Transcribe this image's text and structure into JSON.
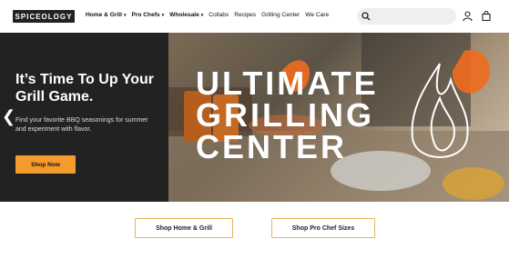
{
  "brand": {
    "logo_text": "SPICEOLOGY"
  },
  "nav": {
    "items": [
      {
        "label": "Home & Grill",
        "caret": "▾"
      },
      {
        "label": "Pro Chefs",
        "caret": "▾"
      },
      {
        "label": "Wholesale",
        "caret": "▾"
      },
      {
        "label": "Collabs",
        "caret": ""
      },
      {
        "label": "Recipes",
        "caret": ""
      },
      {
        "label": "Grilling Center",
        "caret": ""
      },
      {
        "label": "We Care",
        "caret": ""
      }
    ]
  },
  "search": {
    "placeholder": ""
  },
  "hero": {
    "headline": "It’s Time To Up Your Grill Game.",
    "subtext": "Find your favorite BBQ seasonings for summer and experiment with flavor.",
    "cta_label": "Shop Now",
    "banner_lines": [
      "ULTIMATE",
      "GRILLING",
      "CENTER"
    ]
  },
  "bottom_buttons": {
    "home_grill": "Shop Home & Grill",
    "pro_chef": "Shop Pro Chef Sizes"
  },
  "colors": {
    "accent": "#f39c2d",
    "dark": "#222222"
  },
  "icons": [
    "search-icon",
    "user-icon",
    "cart-icon",
    "chevron-left-icon",
    "flame-icon"
  ]
}
